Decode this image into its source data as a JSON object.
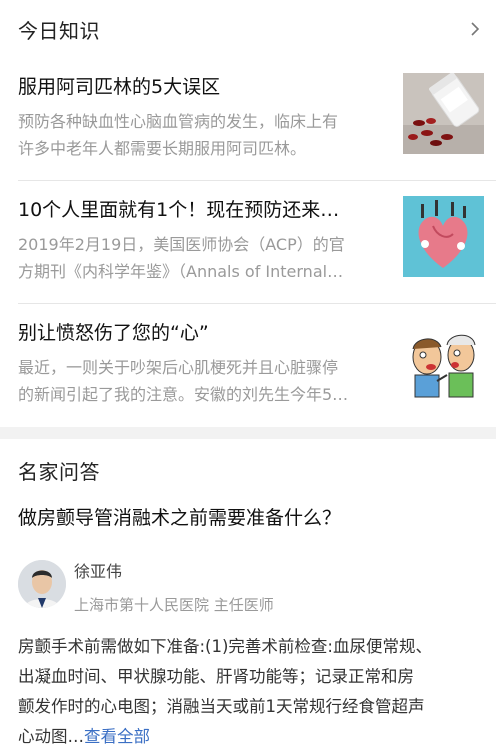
{
  "knowledge": {
    "title": "今日知识",
    "more_icon": "chevron-right-icon",
    "articles": [
      {
        "title": "服用阿司匹林的5大误区",
        "summary_lines": [
          "预防各种缺血性心脑血管病的发生，临床上有",
          "许多中老年人都需要长期服用阿司匹林。"
        ],
        "thumb": "pill-bottle-image"
      },
      {
        "title": "10个人里面就有1个！现在预防还来…",
        "summary_lines": [
          "2019年2月19日，美国医师协会（ACP）的官",
          "方期刊《内科学年鉴》（Annals of Internal…"
        ],
        "thumb": "heart-illustration-image"
      },
      {
        "title": "别让愤怒伤了您的“心”",
        "summary_lines": [
          "最近，一则关于吵架后心肌梗死并且心脏骤停",
          "的新闻引起了我的注意。安徽的刘先生今年5…"
        ],
        "thumb": "arguing-men-illustration"
      }
    ]
  },
  "qa": {
    "title": "名家问答",
    "question": "做房颤导管消融术之前需要准备什么？",
    "expert": {
      "name": "徐亚伟",
      "title": "上海市第十人民医院 主任医师"
    },
    "answer_lines": [
      "房颤手术前需做如下准备:(1)完善术前检查:血尿便常规、",
      "出凝血时间、甲状腺功能、肝肾功能等；记录正常和房",
      "颤发作时的心电图；消融当天或前1天常规行经食管超声"
    ],
    "answer_last": "心动图…",
    "more_label": "查看全部"
  }
}
